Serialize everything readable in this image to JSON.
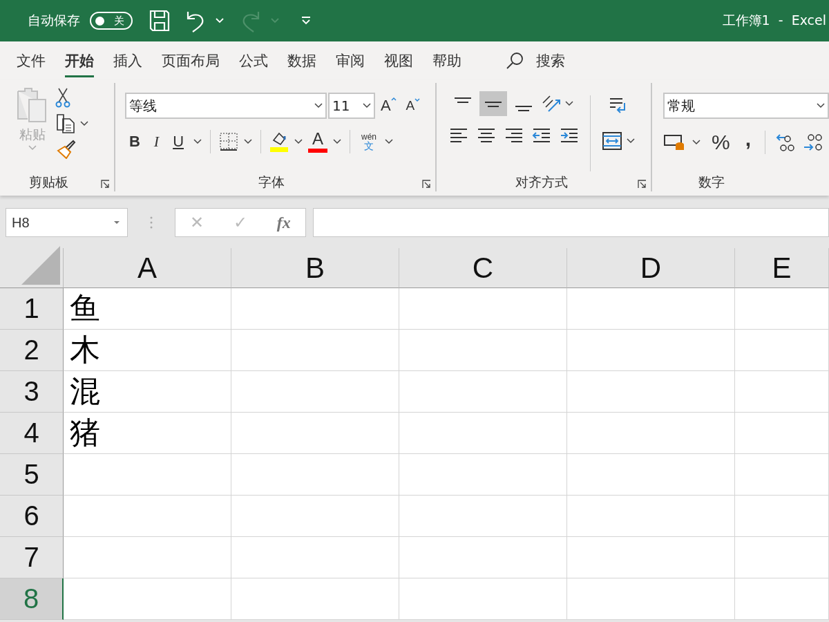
{
  "title_bar": {
    "autosave_label": "自动保存",
    "autosave_toggle": {
      "label": "关",
      "on": false
    },
    "redo_disabled": true,
    "title": "工作簿1  -  Excel"
  },
  "tabs": [
    {
      "label": "文件",
      "selected": false
    },
    {
      "label": "开始",
      "selected": true
    },
    {
      "label": "插入",
      "selected": false
    },
    {
      "label": "页面布局",
      "selected": false
    },
    {
      "label": "公式",
      "selected": false
    },
    {
      "label": "数据",
      "selected": false
    },
    {
      "label": "审阅",
      "selected": false
    },
    {
      "label": "视图",
      "selected": false
    },
    {
      "label": "帮助",
      "selected": false
    }
  ],
  "search": {
    "label": "搜索"
  },
  "clipboard": {
    "paste_label": "粘贴",
    "paste_disabled": true,
    "group_label": "剪贴板"
  },
  "font": {
    "font_name": "等线",
    "font_size": "11",
    "grow": "A",
    "shrink": "A",
    "bold": "B",
    "italic": "I",
    "underline": "U",
    "font_color": "A",
    "phonetic_top": "wén",
    "phonetic_bottom": "文",
    "group_label": "字体"
  },
  "alignment": {
    "vertical": [
      {
        "selected": false
      },
      {
        "selected": true
      },
      {
        "selected": false
      }
    ],
    "group_label": "对齐方式"
  },
  "number": {
    "format": "常规",
    "percent": "%",
    "comma": ",",
    "group_label": "数字"
  },
  "formula_bar": {
    "name_box": "H8",
    "cancel": "✕",
    "enter": "✓",
    "fx": "fx"
  },
  "grid": {
    "columns": [
      {
        "label": "A",
        "selected": false
      },
      {
        "label": "B",
        "selected": false
      },
      {
        "label": "C",
        "selected": false
      },
      {
        "label": "D",
        "selected": false
      },
      {
        "label": "E",
        "selected": false
      }
    ],
    "rows": [
      {
        "label": "1",
        "selected": false,
        "cells": [
          "鱼"
        ]
      },
      {
        "label": "2",
        "selected": false,
        "cells": [
          "木"
        ]
      },
      {
        "label": "3",
        "selected": false,
        "cells": [
          "混"
        ]
      },
      {
        "label": "4",
        "selected": false,
        "cells": [
          "猪"
        ]
      },
      {
        "label": "5",
        "selected": false
      },
      {
        "label": "6",
        "selected": false
      },
      {
        "label": "7",
        "selected": false
      },
      {
        "label": "8",
        "selected": true
      }
    ]
  }
}
